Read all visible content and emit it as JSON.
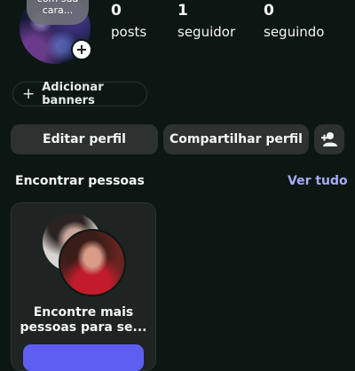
{
  "profile": {
    "avatar_note": "com sua cara...",
    "stats": [
      {
        "value": "0",
        "label": "posts"
      },
      {
        "value": "1",
        "label": "seguidor"
      },
      {
        "value": "0",
        "label": "seguindo"
      }
    ]
  },
  "banners_button": "Adicionar banners",
  "actions": {
    "edit": "Editar perfil",
    "share": "Compartilhar perfil",
    "add_person_icon": "person-add-icon"
  },
  "find_people": {
    "title": "Encontrar pessoas",
    "see_all": "Ver tudo",
    "card_text": "Encontre mais pessoas para se..."
  },
  "colors": {
    "background": "#0c1714",
    "button": "#2b3230",
    "link": "#a5acf5",
    "primary": "#5e5ef0"
  }
}
